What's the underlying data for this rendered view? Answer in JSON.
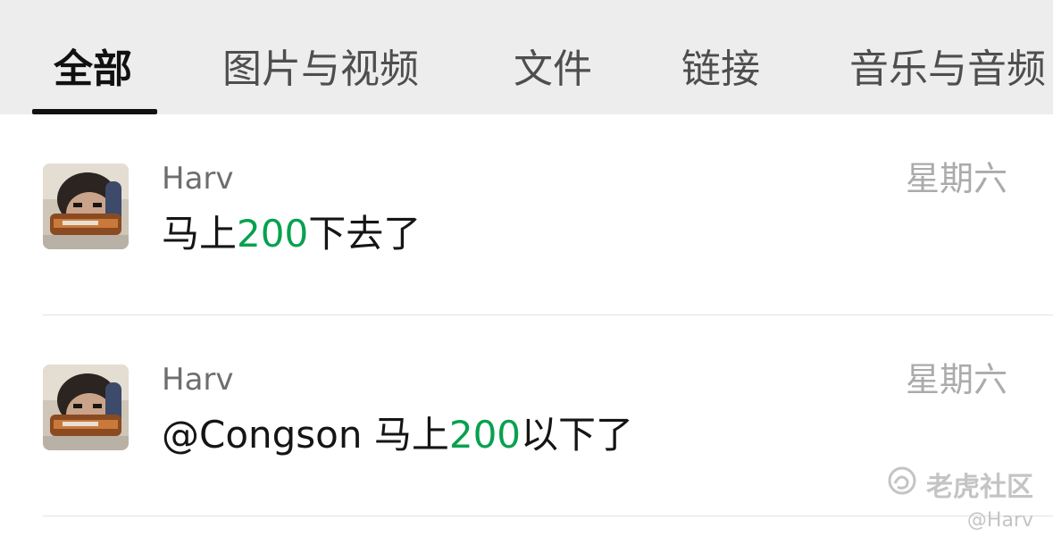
{
  "tabs": {
    "items": [
      {
        "label": "全部",
        "active": true
      },
      {
        "label": "图片与视频",
        "active": false
      },
      {
        "label": "文件",
        "active": false
      },
      {
        "label": "链接",
        "active": false
      },
      {
        "label": "音乐与音频",
        "active": false
      }
    ]
  },
  "messages": [
    {
      "sender": "Harv",
      "time": "星期六",
      "content_pre": "马上",
      "content_num": "200",
      "content_post": "下去了"
    },
    {
      "sender": "Harv",
      "time": "星期六",
      "content_pre": "@Congson 马上",
      "content_num": "200",
      "content_post": "以下了"
    }
  ],
  "watermark": {
    "brand": "老虎社区",
    "user": "@Harv",
    "icon": "tiger-community-logo-icon"
  },
  "colors": {
    "tab_bar_bg": "#ededed",
    "active_tab": "#111111",
    "number_highlight": "#07a14f",
    "time_text": "#ababab",
    "sender_text": "#6e6e6e"
  }
}
